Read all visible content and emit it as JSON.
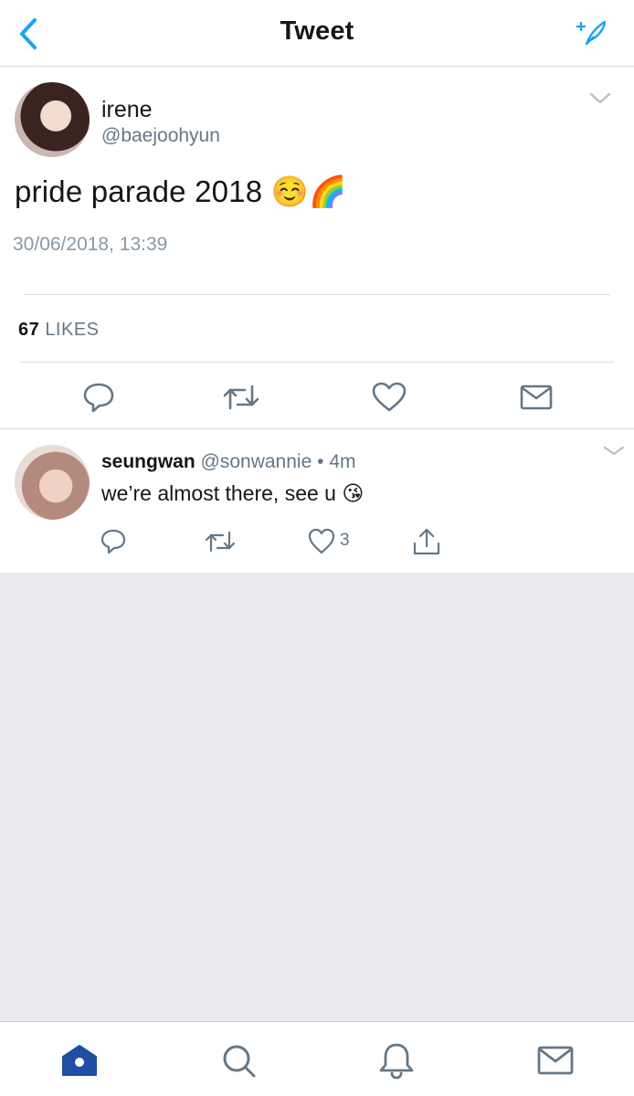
{
  "nav": {
    "title": "Tweet",
    "back_icon": "chevron-left-icon",
    "compose_icon": "compose-sparkle-icon"
  },
  "colors": {
    "accent": "#1da1f2",
    "secondary_text": "#657786",
    "divider": "#d8dce0",
    "background_gray": "#e9e9ee",
    "tab_active": "#1d4fa3"
  },
  "main_tweet": {
    "name": "irene",
    "handle": "@baejoohyun",
    "text": "pride parade 2018",
    "emojis": "☺️🌈",
    "timestamp": "30/06/2018, 13:39",
    "likes_count": "67",
    "likes_label": "LIKES",
    "actions": [
      "reply-icon",
      "retweet-icon",
      "like-icon",
      "direct-message-icon"
    ]
  },
  "reply": {
    "name": "seungwan",
    "handle": "@sonwannie",
    "separator": "•",
    "time": "4m",
    "text": "we’re almost there, see u",
    "emoji": "😘",
    "like_count": "3",
    "actions": [
      "reply-icon",
      "retweet-icon",
      "like-icon",
      "share-icon"
    ]
  },
  "tab_bar": {
    "tabs": [
      {
        "name": "home",
        "icon": "home-icon",
        "active": true
      },
      {
        "name": "search",
        "icon": "search-icon",
        "active": false
      },
      {
        "name": "notifications",
        "icon": "bell-icon",
        "active": false
      },
      {
        "name": "messages",
        "icon": "mail-icon",
        "active": false
      }
    ]
  }
}
